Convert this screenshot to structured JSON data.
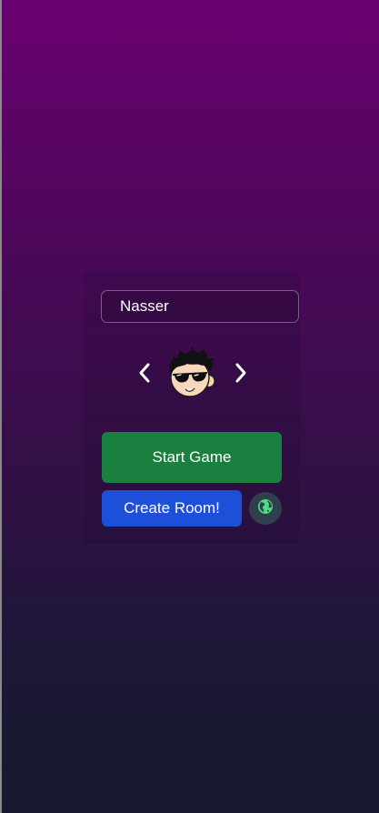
{
  "player": {
    "name": "Nasser"
  },
  "avatar_selector": {
    "prev_icon": "chevron-left-icon",
    "next_icon": "chevron-right-icon",
    "avatar": "cool-guy-sunglasses-avatar"
  },
  "actions": {
    "start_label": "Start Game",
    "create_room_label": "Create Room!",
    "public_rooms_icon": "globe-icon"
  },
  "colors": {
    "start_button": "#1a8040",
    "create_room_button": "#1d4fd8",
    "globe_button": "#2f3f4c",
    "globe_icon": "#4ade80"
  }
}
